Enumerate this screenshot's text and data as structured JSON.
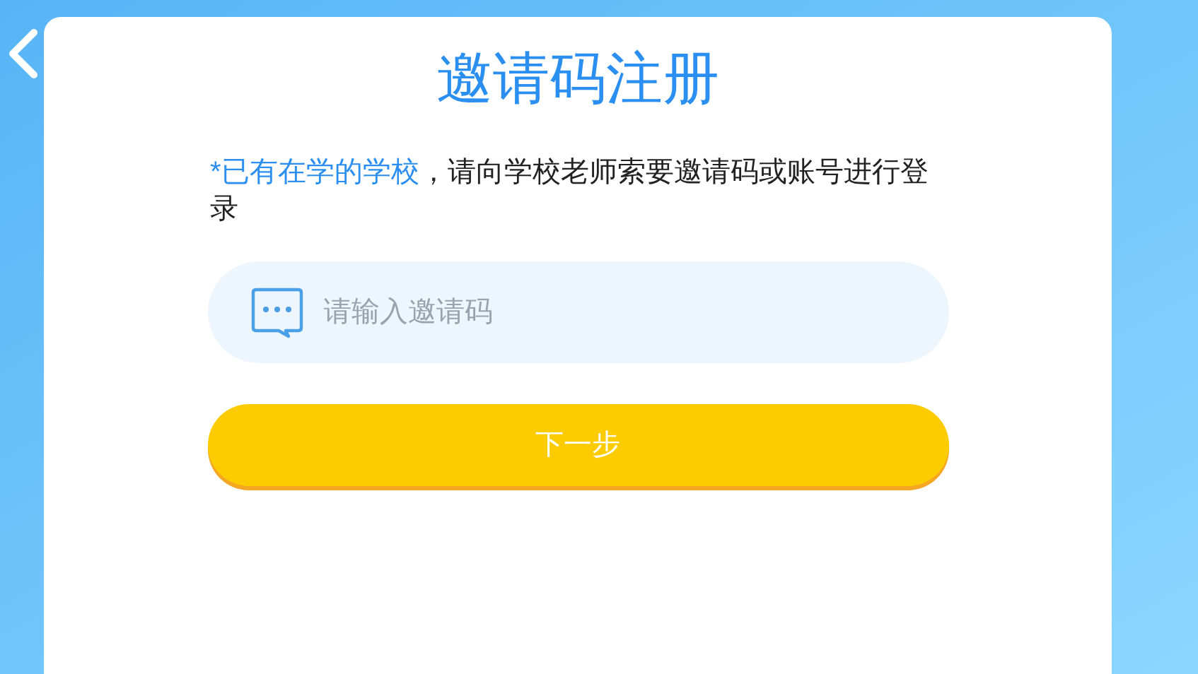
{
  "title": "邀请码注册",
  "notice": {
    "highlight": "*已有在学的学校",
    "text": "，请向学校老师索要邀请码或账号进行登录"
  },
  "invite_field": {
    "placeholder": "请输入邀请码"
  },
  "next_button": {
    "label": "下一步"
  }
}
